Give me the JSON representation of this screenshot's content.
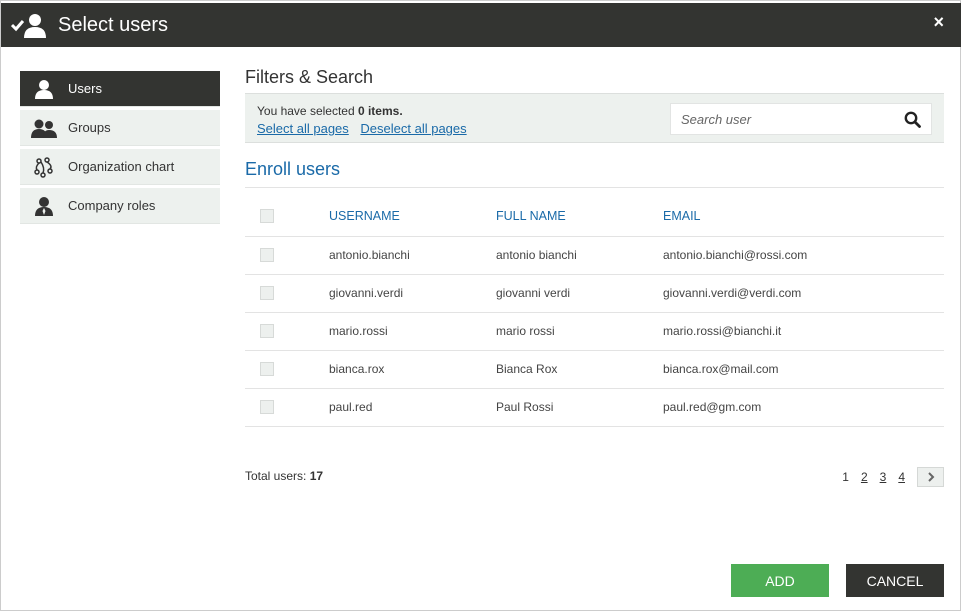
{
  "header": {
    "title": "Select users",
    "close_icon": "×"
  },
  "sidebar": {
    "items": [
      {
        "label": "Users",
        "icon": "user-icon",
        "active": true
      },
      {
        "label": "Groups",
        "icon": "groups-icon",
        "active": false
      },
      {
        "label": "Organization chart",
        "icon": "org-chart-icon",
        "active": false
      },
      {
        "label": "Company roles",
        "icon": "company-role-icon",
        "active": false
      }
    ]
  },
  "filters": {
    "heading": "Filters & Search",
    "selected_prefix": "You have selected ",
    "selected_count": "0 items.",
    "select_all": "Select all pages",
    "deselect_all": "Deselect all pages",
    "search_placeholder": "Search user",
    "search_value": ""
  },
  "enroll": {
    "heading": "Enroll users",
    "columns": [
      "USERNAME",
      "FULL NAME",
      "EMAIL"
    ],
    "rows": [
      {
        "username": "antonio.bianchi",
        "fullname": "antonio bianchi",
        "email": "antonio.bianchi@rossi.com"
      },
      {
        "username": "giovanni.verdi",
        "fullname": "giovanni verdi",
        "email": "giovanni.verdi@verdi.com"
      },
      {
        "username": "mario.rossi",
        "fullname": "mario rossi",
        "email": "mario.rossi@bianchi.it"
      },
      {
        "username": "bianca.rox",
        "fullname": "Bianca Rox",
        "email": "bianca.rox@mail.com"
      },
      {
        "username": "paul.red",
        "fullname": "Paul Rossi",
        "email": "paul.red@gm.com"
      }
    ]
  },
  "footer": {
    "total_label": "Total users: ",
    "total_value": "17",
    "pages": [
      "1",
      "2",
      "3",
      "4"
    ],
    "current_page": "1"
  },
  "actions": {
    "add": "ADD",
    "cancel": "CANCEL"
  },
  "colors": {
    "header_bg": "#333431",
    "accent_blue": "#1a6aa8",
    "add_green": "#4dad55",
    "panel_bg": "#edf1ee"
  }
}
